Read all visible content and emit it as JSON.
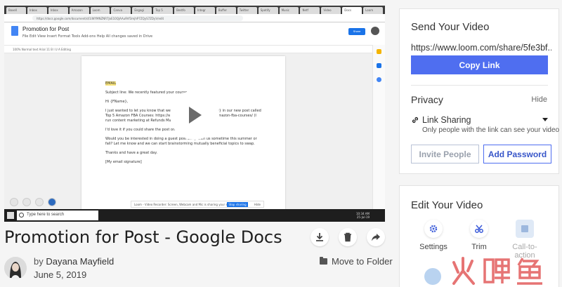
{
  "video": {
    "browser_tabs": [
      "Boxell",
      "Inbox",
      "Inbox",
      "Amazon",
      "Loom",
      "Canva",
      "Engagi",
      "Top 5",
      "Bestfo",
      "Integr",
      "Buffer",
      "Twitter",
      "Spotify",
      "Music",
      "Netf",
      "Video",
      "Docs",
      "Loom"
    ],
    "url": "https://docs.google.com/document/d/1iWYMNZNR7JxE10QjAAu9Vf3mjhP7ZQyS7ZDyV/edit",
    "doc_title": "Promotion for Post",
    "doc_menu": "File  Edit  View  Insert  Format  Tools  Add-ons  Help  All changes saved in Drive",
    "share_label": "Share",
    "toolbar_text": "100%   Normal text   Arial   11   B  I  U  A          Editing",
    "doc_lines": [
      "EMAIL",
      "Subject line: We recently featured your course",
      "Hi {FName},",
      "I just wanted to let you know that we've featured {Course Name} in our new post called Top 5 Amazon FBA Courses: https://www.refundsmanager.com/amazon-fba-courses/ (I run content marketing at Refunds Manager).",
      "I'd love it if you could share the post on social!",
      "Would you be interested in doing a guest post swap with us sometime this summer or fall? Let me know and we can start brainstorming mutually beneficial topics to swap.",
      "Thanks and have a great day.",
      "[My email signature]"
    ],
    "popup_text": "Loom - Video Recorder: Screen, Webcam and Mic is sharing your screen.",
    "popup_stop": "Stop sharing",
    "popup_hide": "Hide",
    "taskbar_search": "Type here to search",
    "tray_time": "10:34 AM",
    "tray_date": "25-Jul-19"
  },
  "title": "Promotion for Post - Google Docs",
  "owner": {
    "prefix": "by",
    "name": "Dayana Mayfield"
  },
  "date": "June 5, 2019",
  "move_to_folder": "Move to Folder",
  "icons": [
    "download-icon",
    "trash-icon",
    "share-arrow-icon",
    "folder-icon",
    "link-icon",
    "gear-icon",
    "scissors-icon",
    "call-to-action-icon"
  ],
  "send_panel": {
    "title": "Send Your Video",
    "url": "https://www.loom.com/share/5fe3bf...",
    "copy_link": "Copy Link",
    "privacy": "Privacy",
    "hide": "Hide",
    "link_sharing": "Link Sharing",
    "sharing_desc": "Only people with the link can see your video",
    "invite_people": "Invite People",
    "add_password": "Add Password"
  },
  "edit_panel": {
    "title": "Edit Your Video",
    "tools": [
      "Settings",
      "Trim",
      "Call-to-action"
    ]
  },
  "watermark": "火鲤鱼",
  "colors": {
    "primary": "#4f6ef0",
    "primary_dark": "#3856c9",
    "watermark": "#e25c5c"
  }
}
